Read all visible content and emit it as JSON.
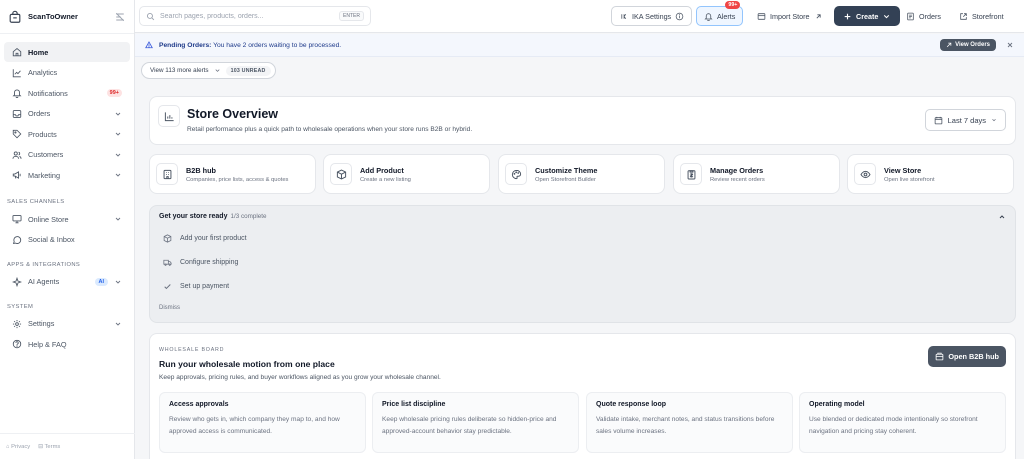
{
  "brand": {
    "name": "ScanToOwner",
    "logo_icon": "store-bag-icon"
  },
  "sidebar": {
    "items": [
      {
        "label": "Home",
        "icon": "home-icon"
      },
      {
        "label": "Analytics",
        "icon": "chart-line-icon"
      },
      {
        "label": "Notifications",
        "icon": "bell-icon",
        "badge": "99+"
      },
      {
        "label": "Orders",
        "icon": "inbox-icon"
      },
      {
        "label": "Products",
        "icon": "tag-icon"
      },
      {
        "label": "Customers",
        "icon": "users-icon"
      },
      {
        "label": "Marketing",
        "icon": "megaphone-icon"
      }
    ],
    "sections": {
      "sales": {
        "label": "SALES CHANNELS",
        "items": [
          {
            "label": "Online Store"
          },
          {
            "label": "Social & Inbox"
          }
        ]
      },
      "apps": {
        "label": "APPS & INTEGRATIONS",
        "items": [
          {
            "label": "AI Agents",
            "badge": "AI"
          }
        ]
      },
      "system": {
        "label": "SYSTEM",
        "items": [
          {
            "label": "Settings"
          },
          {
            "label": "Help & FAQ"
          }
        ]
      }
    },
    "footer": {
      "privacy": "Privacy",
      "terms": "Terms"
    }
  },
  "topbar": {
    "search_placeholder": "Search pages, products, orders...",
    "search_value": "",
    "search_hint": "ENTER",
    "ika_settings": "IKA Settings",
    "alerts": "Alerts",
    "alerts_count": "99+",
    "import_store": "Import Store",
    "create": "Create",
    "orders": "Orders",
    "storefront": "Storefront"
  },
  "banner": {
    "prefix": "Pending Orders:",
    "message": "You have 2 orders waiting to be processed.",
    "action": "View Orders"
  },
  "alerts_chip": {
    "label": "View 113 more alerts",
    "unread": "103 UNREAD"
  },
  "overview": {
    "title": "Store Overview",
    "subtitle": "Retail performance plus a quick path to wholesale operations when your store runs B2B or hybrid.",
    "range": "Last 7 days"
  },
  "quick_actions": [
    {
      "title": "B2B hub",
      "subtitle": "Companies, price lists, access & quotes",
      "icon": "building-icon"
    },
    {
      "title": "Add Product",
      "subtitle": "Create a new listing",
      "icon": "box-icon"
    },
    {
      "title": "Customize Theme",
      "subtitle": "Open Storefront Builder",
      "icon": "palette-icon"
    },
    {
      "title": "Manage Orders",
      "subtitle": "Review recent orders",
      "icon": "clipboard-icon"
    },
    {
      "title": "View Store",
      "subtitle": "Open live storefront",
      "icon": "eye-icon"
    }
  ],
  "setup": {
    "title": "Get your store ready",
    "progress": "1/3 complete",
    "steps": [
      {
        "label": "Add your first product",
        "done": false
      },
      {
        "label": "Configure shipping",
        "done": false
      },
      {
        "label": "Set up payment",
        "done": true
      }
    ],
    "dismiss": "Dismiss"
  },
  "wholesale": {
    "kicker": "WHOLESALE BOARD",
    "title": "Run your wholesale motion from one place",
    "subtitle": "Keep approvals, pricing rules, and buyer workflows aligned as you grow your wholesale channel.",
    "button": "Open B2B hub",
    "tiles": [
      {
        "title": "Access approvals",
        "desc": "Review who gets in, which company they map to, and how approved access is communicated."
      },
      {
        "title": "Price list discipline",
        "desc": "Keep wholesale pricing rules deliberate so hidden-price and approved-account behavior stay predictable."
      },
      {
        "title": "Quote response loop",
        "desc": "Validate intake, merchant notes, and status transitions before sales volume increases."
      },
      {
        "title": "Operating model",
        "desc": "Use blended or dedicated mode intentionally so storefront navigation and pricing stay coherent."
      }
    ]
  },
  "colors": {
    "accent": "#334155",
    "alert_red": "#ef4444",
    "banner_bg": "#f4f7fd",
    "banner_text": "#1e3a8a"
  }
}
